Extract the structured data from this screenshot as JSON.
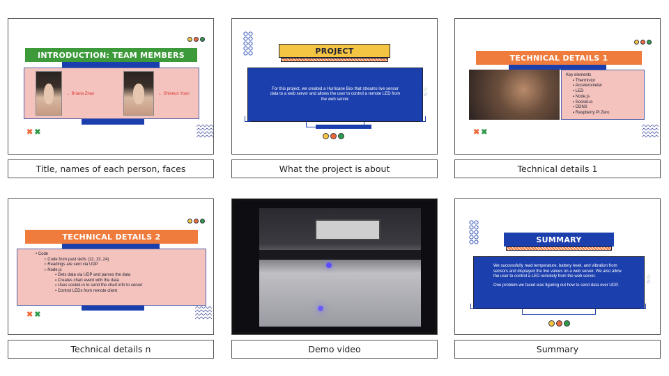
{
  "slides": [
    {
      "caption": "Title, names of each person, faces",
      "title": "INTRODUCTION: TEAM MEMBERS",
      "members": [
        {
          "label": "← Briana Zhao"
        },
        {
          "label": "← Shineun Yoon"
        }
      ]
    },
    {
      "caption": "What the project is about",
      "title": "PROJECT",
      "body": "For this project, we created a Hurricane Box that streams live sensor data to a web server and allows the user to control a remote LED from the web server."
    },
    {
      "caption": "Technical details 1",
      "title": "TECHNICAL DETAILS 1",
      "list_heading": "Key elements",
      "list": [
        "Thermistor",
        "Accelerometer",
        "LED",
        "Node.js",
        "Socket.io",
        "DDNS",
        "Raspberry Pi Zero"
      ]
    },
    {
      "caption": "Technical details n",
      "title": "TECHNICAL DETAILS 2",
      "outline": {
        "top": "Code",
        "items": [
          {
            "text": "Code from past skills (12, 13, 24)"
          },
          {
            "text": "Readings are sent via UDP"
          },
          {
            "text": "Node.js"
          }
        ],
        "subitems": [
          "Gets data via UDP and parses the data",
          "Creates chart event with the data",
          "Uses socket.io to send the chart info to server",
          "Control LEDs from remote client"
        ]
      }
    },
    {
      "caption": "Demo video"
    },
    {
      "caption": "Summary",
      "title": "SUMMARY",
      "para1": "We successfully read temperature, battery level, and vibration from sensors and displayed the live values on a web server. We also allow the user to control a LED remotely from the web server.",
      "para2": "One problem we faced was figuring out how to send data over UDP."
    }
  ],
  "colors": {
    "green_bar": "#3c9a3a",
    "yellow_bar": "#f4c542",
    "orange_bar": "#ef7b3c",
    "blue": "#1c3fae",
    "pink": "#f4c3bd"
  }
}
